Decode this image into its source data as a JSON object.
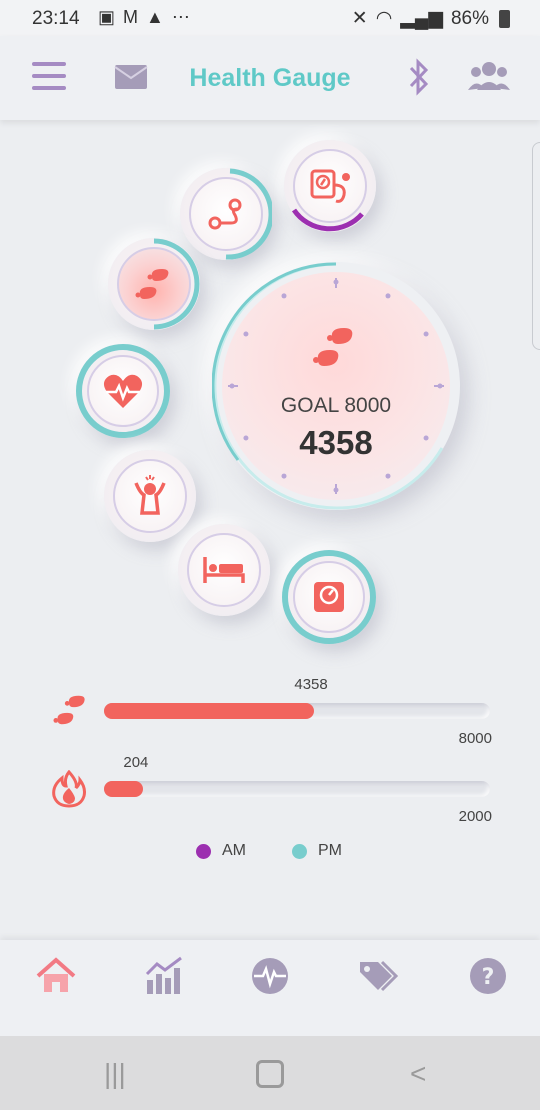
{
  "status_bar": {
    "time": "23:14",
    "battery": "86%"
  },
  "header": {
    "title": "Health Gauge",
    "icons": [
      "menu-icon",
      "mail-icon",
      "bluetooth-icon",
      "group-icon"
    ]
  },
  "gauge": {
    "goal_label": "GOAL 8000",
    "value": "4358",
    "icon": "footsteps-icon"
  },
  "features": [
    {
      "name": "route",
      "icon": "route-icon"
    },
    {
      "name": "blood-pressure",
      "icon": "blood-pressure-icon"
    },
    {
      "name": "steps",
      "icon": "footsteps-icon"
    },
    {
      "name": "heart-rate",
      "icon": "heart-rate-icon"
    },
    {
      "name": "stress",
      "icon": "stress-icon"
    },
    {
      "name": "sleep",
      "icon": "bed-icon"
    },
    {
      "name": "weight",
      "icon": "scale-icon"
    }
  ],
  "progress": {
    "steps": {
      "value": "4358",
      "max": "8000",
      "fraction": 0.545,
      "icon": "footsteps-icon"
    },
    "calories": {
      "value": "204",
      "max": "2000",
      "fraction": 0.102,
      "icon": "flame-icon"
    }
  },
  "legend": {
    "am": {
      "label": "AM",
      "color": "#9c2fb0"
    },
    "pm": {
      "label": "PM",
      "color": "#78cdcd"
    }
  },
  "colors": {
    "accent": "#5fc9c7",
    "brand_purple": "#a58bc3",
    "icon_red": "#f2645e"
  },
  "bottom_nav": [
    {
      "name": "home",
      "icon": "home-icon",
      "active": true
    },
    {
      "name": "stats",
      "icon": "chart-icon"
    },
    {
      "name": "pulse",
      "icon": "pulse-icon"
    },
    {
      "name": "tags",
      "icon": "tags-icon"
    },
    {
      "name": "help",
      "icon": "help-icon"
    }
  ]
}
